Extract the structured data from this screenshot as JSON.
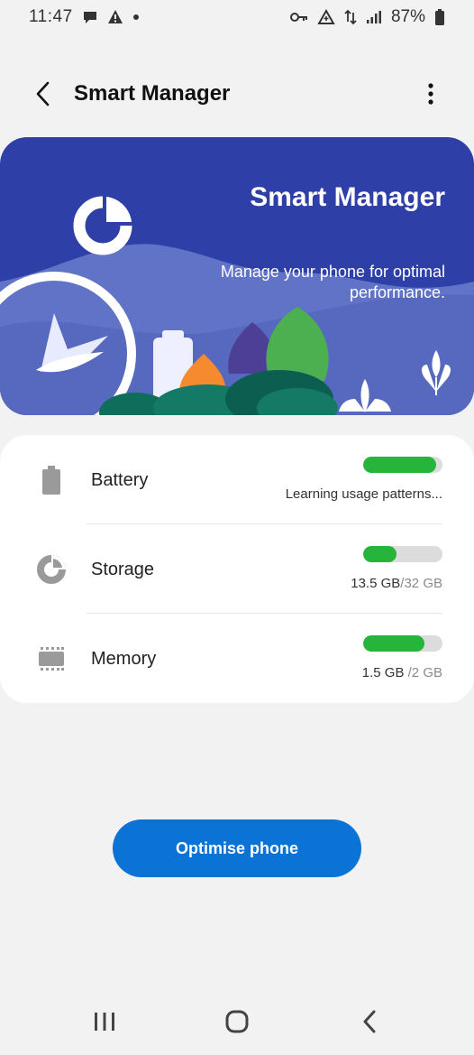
{
  "status_bar": {
    "time": "11:47",
    "battery_percent": "87%",
    "left_icons": [
      "chat-icon",
      "warning-icon",
      "dot-icon"
    ],
    "right_icons": [
      "key-icon",
      "data-saver-icon",
      "data-arrows-icon",
      "signal-icon",
      "battery-icon"
    ]
  },
  "app_bar": {
    "title": "Smart Manager",
    "back_icon": "back-chevron-icon",
    "more_icon": "more-vertical-icon"
  },
  "hero": {
    "title": "Smart Manager",
    "subtitle": "Manage your phone for optimal performance.",
    "background_color": "#2e3fa8"
  },
  "items": [
    {
      "label": "Battery",
      "icon": "battery-icon",
      "info_main": "Learning usage patterns...",
      "info_muted": "",
      "level": 0.92
    },
    {
      "label": "Storage",
      "icon": "storage-pie-icon",
      "info_main": "13.5 GB",
      "info_muted": "/32 GB",
      "level": 0.42
    },
    {
      "label": "Memory",
      "icon": "memory-chip-icon",
      "info_main": "1.5 GB ",
      "info_muted": "/2 GB",
      "level": 0.77
    }
  ],
  "accent_color": "#26b53a",
  "optimise_button": {
    "label": "Optimise phone",
    "color": "#0b72d6"
  },
  "nav_bar": {
    "recents_icon": "recents-icon",
    "home_icon": "home-icon",
    "back_icon": "back-icon"
  }
}
